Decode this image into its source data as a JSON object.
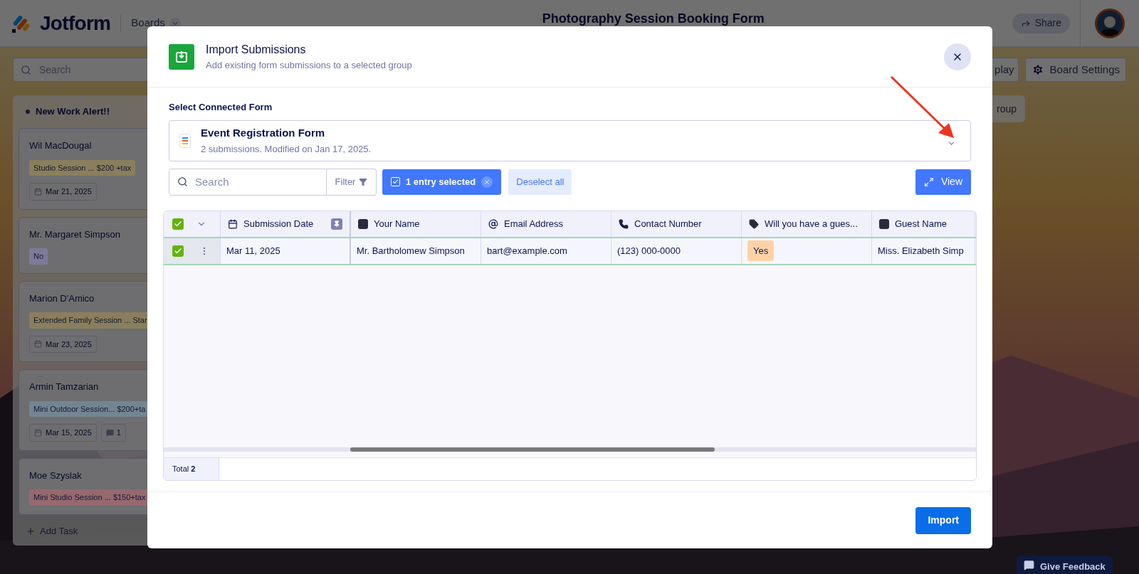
{
  "header": {
    "logo": "Jotform",
    "nav": "Boards",
    "title": "Photography Session Booking Form",
    "share": "Share"
  },
  "toolbar": {
    "search_placeholder": "Search",
    "buttons": [
      {
        "label": "play",
        "kind": "plain"
      },
      {
        "label": "Board Settings",
        "kind": "settings"
      }
    ]
  },
  "column": {
    "title": "New Work Alert!!",
    "cards": [
      {
        "name": "Wil MacDougal",
        "tags": [
          {
            "text": "Studio Session ... $200 +tax",
            "color": "#8a7f5c"
          }
        ],
        "date": "Mar 21, 2025"
      },
      {
        "name": "Mr. Margaret Simpson",
        "tags": [
          {
            "text": "No",
            "color": "#7c7b98"
          }
        ]
      },
      {
        "name": "Marion D'Amico",
        "tags": [
          {
            "text": "Extended Family Session ... Star",
            "color": "#8a7f5c"
          }
        ],
        "date": "Mar 23, 2025"
      },
      {
        "name": "Armin Tamzarian",
        "tags": [
          {
            "text": "Mini Outdoor Session... $200+ta",
            "color": "#738592"
          }
        ],
        "date": "Mar 15, 2025",
        "comments": "1"
      },
      {
        "name": "Moe Szyslak",
        "tags": [
          {
            "text": "Mini Studio Session ... $150+tax",
            "color": "#96696f"
          }
        ]
      }
    ],
    "add_task": "Add Task"
  },
  "add_group": "roup",
  "modal": {
    "title": "Import Submissions",
    "subtitle": "Add existing form submissions to a selected group",
    "form_label": "Select Connected Form",
    "form": {
      "name": "Event Registration Form",
      "meta": "2 submissions. Modified on Jan 17, 2025."
    },
    "search_placeholder": "Search",
    "filter": "Filter",
    "selected_chip": "1 entry selected",
    "deselect": "Deselect all",
    "view": "View",
    "table": {
      "all_checked": true,
      "columns": [
        {
          "label": "Submission Date",
          "kind": "date"
        },
        {
          "label": "Your Name",
          "kind": "text"
        },
        {
          "label": "Email Address",
          "kind": "email"
        },
        {
          "label": "Contact Number",
          "kind": "phone"
        },
        {
          "label": "Will you have a gues...",
          "kind": "tag"
        },
        {
          "label": "Guest Name",
          "kind": "text"
        }
      ],
      "rows": [
        {
          "selected": true,
          "cells": [
            "Mar 11, 2025",
            "Mr. Bartholomew Simpson",
            "bart@example.com",
            "(123) 000-0000",
            "Yes",
            "Miss. Elizabeth Simp"
          ]
        }
      ],
      "total_label": "Total",
      "total": "2"
    },
    "import": "Import"
  },
  "feedback": "Give Feedback"
}
